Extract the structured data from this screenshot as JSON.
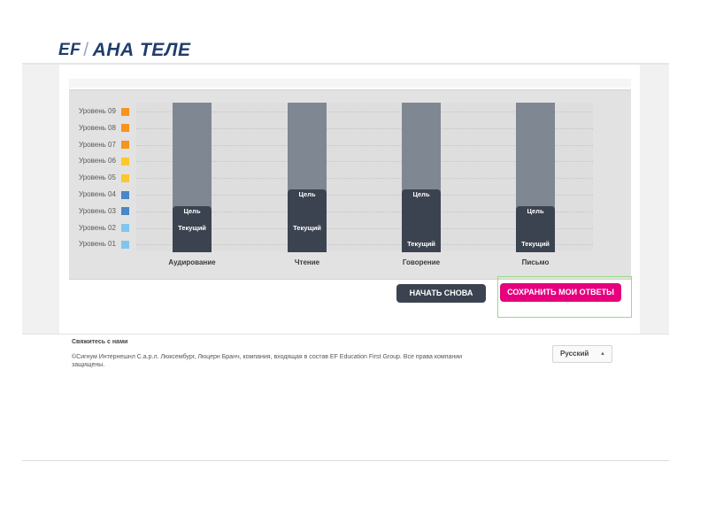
{
  "header": {
    "brand_ef": "EF",
    "brand_name": "АНА ТЕЛЕ"
  },
  "levels": [
    {
      "label": "Уровень 09",
      "color": "#f7941d"
    },
    {
      "label": "Уровень 08",
      "color": "#f7941d"
    },
    {
      "label": "Уровень 07",
      "color": "#f7941d"
    },
    {
      "label": "Уровень 06",
      "color": "#fdc72e"
    },
    {
      "label": "Уровень 05",
      "color": "#fdc72e"
    },
    {
      "label": "Уровень 04",
      "color": "#4a86c8"
    },
    {
      "label": "Уровень 03",
      "color": "#4a86c8"
    },
    {
      "label": "Уровень 02",
      "color": "#7fc7ea"
    },
    {
      "label": "Уровень 01",
      "color": "#7fc7ea"
    }
  ],
  "chart_data": {
    "type": "bar",
    "categories": [
      "Аудирование",
      "Чтение",
      "Говорение",
      "Письмо"
    ],
    "y_categories": [
      "Уровень 01",
      "Уровень 02",
      "Уровень 03",
      "Уровень 04",
      "Уровень 05",
      "Уровень 06",
      "Уровень 07",
      "Уровень 08",
      "Уровень 09"
    ],
    "series": [
      {
        "name": "Цель",
        "values": [
          3,
          4,
          4,
          3
        ]
      },
      {
        "name": "Текущий",
        "values": [
          2,
          2,
          1,
          1
        ]
      }
    ],
    "ylim": [
      1,
      9
    ],
    "badge_goal": "Цель",
    "badge_current": "Текущий"
  },
  "buttons": {
    "restart": "НАЧАТЬ СНОВА",
    "save": "СОХРАНИТЬ МОИ ОТВЕТЫ"
  },
  "footer": {
    "contact": "Свяжитесь с нами",
    "copyright": "©Сигнум Интернешнл С.а.р.л. Люксембург, Люцерн Бранч, компания, входящая в состав EF Education First Group. Все права компании защищены.",
    "language": "Русский"
  },
  "colors": {
    "accent": "#e6007e",
    "dark_button": "#3c4350",
    "bar_track": "#7f8792"
  }
}
